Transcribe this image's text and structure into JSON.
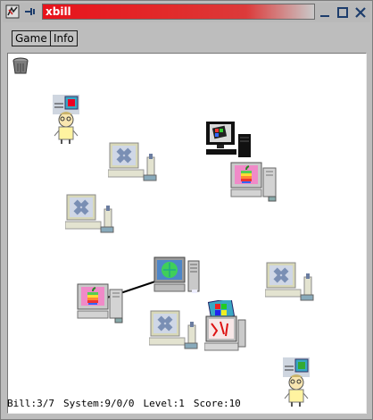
{
  "window": {
    "title": "xbill"
  },
  "menu": {
    "game_label": "Game",
    "info_label": "Info"
  },
  "status": {
    "bill": "Bill:3/7",
    "system": "System:9/0/0",
    "level": "Level:1",
    "score": "Score:10"
  },
  "colors": {
    "title_bar": "#e8121b",
    "playfield": "#ffffff",
    "chrome": "#bdbdbd"
  },
  "sprites": [
    {
      "name": "trash-can-icon"
    },
    {
      "name": "bill-character-1"
    },
    {
      "name": "bill-character-2"
    },
    {
      "name": "next-computer"
    },
    {
      "name": "mac-computer-1"
    },
    {
      "name": "mac-computer-2"
    },
    {
      "name": "sun-computer-1"
    },
    {
      "name": "sun-computer-2"
    },
    {
      "name": "sun-computer-3"
    },
    {
      "name": "sun-computer-4"
    },
    {
      "name": "hurd-computer"
    },
    {
      "name": "infected-computer"
    },
    {
      "name": "network-cable"
    }
  ]
}
